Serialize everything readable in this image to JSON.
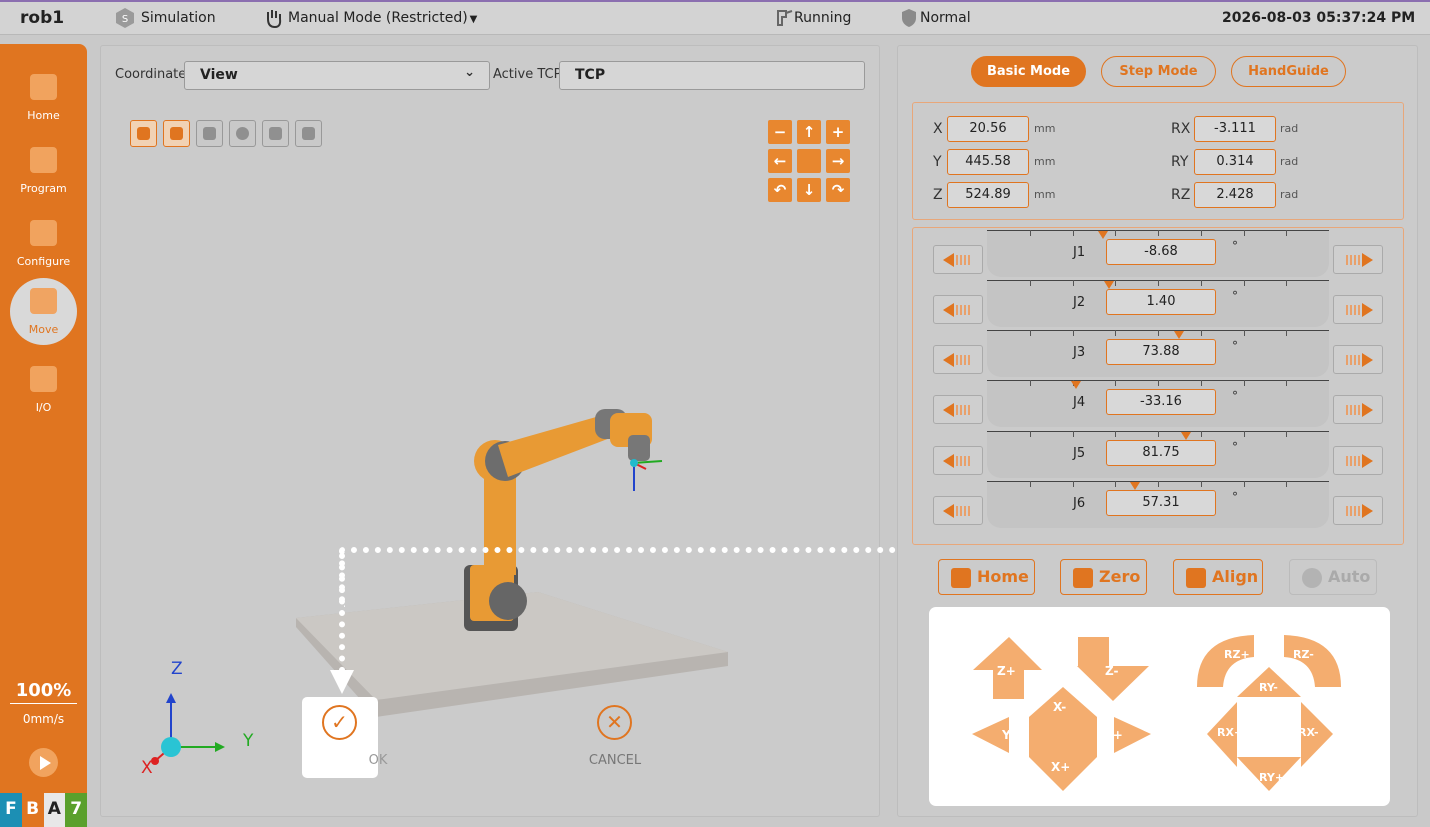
{
  "topbar": {
    "robot_name": "rob1",
    "simulation": "Simulation",
    "mode": "Manual Mode (Restricted)",
    "status": "Running",
    "safety": "Normal",
    "datetime": "2026-08-03 05:37:24 PM"
  },
  "sidebar": {
    "items": [
      {
        "label": "Home",
        "icon": "home-icon"
      },
      {
        "label": "Program",
        "icon": "code-icon"
      },
      {
        "label": "Configure",
        "icon": "download-icon"
      },
      {
        "label": "Move",
        "icon": "move-icon"
      },
      {
        "label": "I/O",
        "icon": "io-icon"
      }
    ],
    "speed_percent": "100%",
    "speed_value": "0mm/s",
    "fba7": [
      "F",
      "B",
      "A",
      "7"
    ]
  },
  "view_panel": {
    "coordinate_label": "Coordinate",
    "coordinate_value": "View",
    "active_tcp_label": "Active TCP",
    "active_tcp_value": "TCP",
    "axes": {
      "z": "Z",
      "y": "Y",
      "x": "X"
    },
    "ok_label": "OK",
    "cancel_label": "CANCEL"
  },
  "move_panel": {
    "modes": [
      "Basic Mode",
      "Step Mode",
      "HandGuide"
    ],
    "active_mode": "Basic Mode",
    "cartesian": [
      {
        "label": "X",
        "value": "20.56",
        "unit": "mm"
      },
      {
        "label": "Y",
        "value": "445.58",
        "unit": "mm"
      },
      {
        "label": "Z",
        "value": "524.89",
        "unit": "mm"
      },
      {
        "label": "RX",
        "value": "-3.111",
        "unit": "rad"
      },
      {
        "label": "RY",
        "value": "0.314",
        "unit": "rad"
      },
      {
        "label": "RZ",
        "value": "2.428",
        "unit": "rad"
      }
    ],
    "joints": [
      {
        "name": "J1",
        "value": "-8.68",
        "unit": "°"
      },
      {
        "name": "J2",
        "value": "1.40",
        "unit": "°"
      },
      {
        "name": "J3",
        "value": "73.88",
        "unit": "°"
      },
      {
        "name": "J4",
        "value": "-33.16",
        "unit": "°"
      },
      {
        "name": "J5",
        "value": "81.75",
        "unit": "°"
      },
      {
        "name": "J6",
        "value": "57.31",
        "unit": "°"
      }
    ],
    "actions": [
      "Home",
      "Zero",
      "Align",
      "Auto"
    ],
    "jog_translate": [
      "Z+",
      "Z-",
      "X-",
      "Y-",
      "Y+",
      "X+"
    ],
    "jog_rotate": [
      "RZ+",
      "RZ-",
      "RY-",
      "RX+",
      "RX-",
      "RY+"
    ]
  },
  "colors": {
    "accent": "#e07520",
    "panel": "#cbcbcb"
  }
}
